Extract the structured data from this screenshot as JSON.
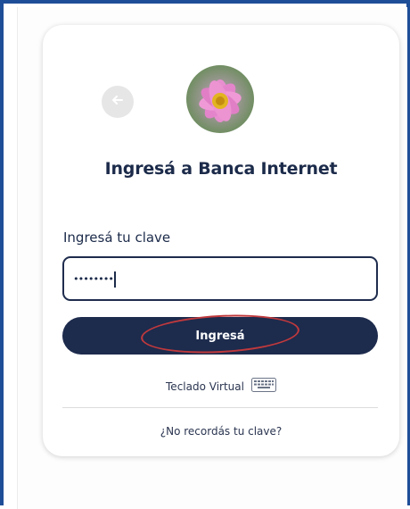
{
  "login": {
    "title": "Ingresá a Banca Internet",
    "password_label": "Ingresá tu clave",
    "password_value": "••••••••",
    "submit_label": "Ingresá",
    "virtual_keyboard_label": "Teclado Virtual",
    "forgot_password_label": "¿No recordás tu clave?"
  },
  "icons": {
    "back": "arrow-left-icon",
    "avatar": "flower-avatar",
    "keyboard": "keyboard-icon"
  },
  "colors": {
    "brand_navy": "#1d2b4d",
    "frame_blue": "#1f4e98",
    "annotation_red": "#c0393c",
    "avatar_pink": "#e685c8"
  }
}
